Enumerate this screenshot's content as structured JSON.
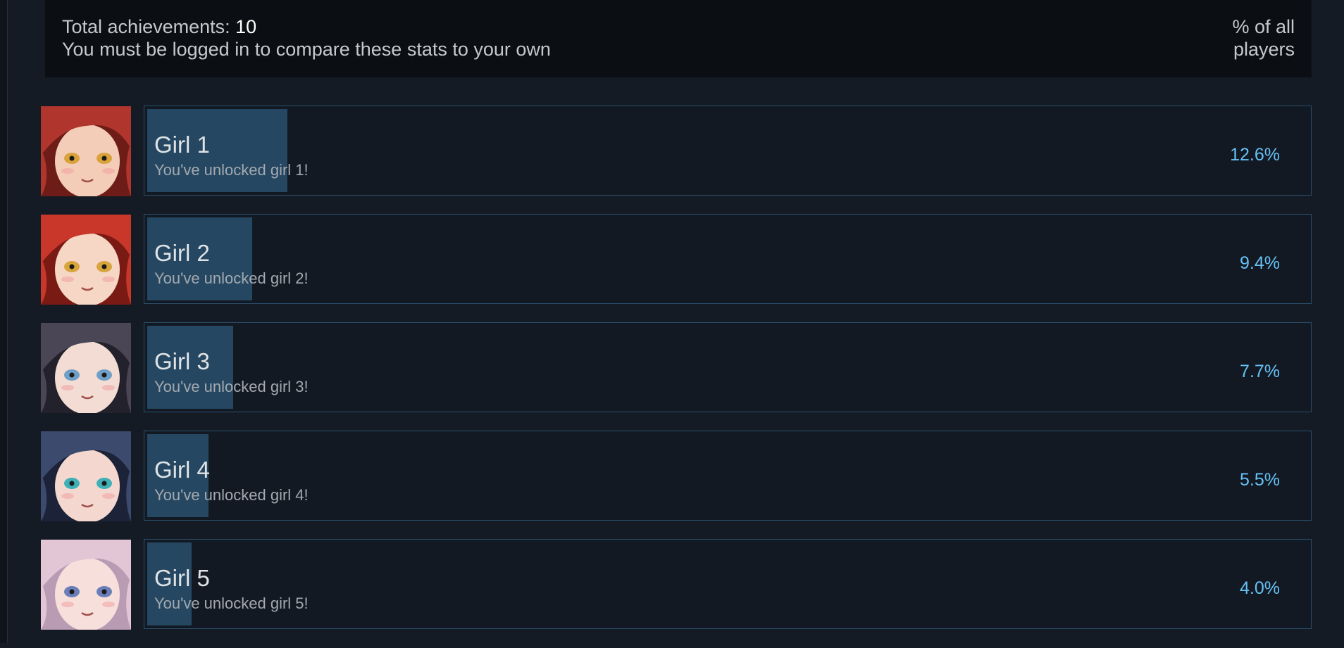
{
  "header": {
    "total_label": "Total achievements: ",
    "total_value": "10",
    "login_notice": "You must be logged in to compare these stats to your own",
    "percent_label": "% of all players"
  },
  "colors": {
    "background": "#151b25",
    "header_bg": "#0b0e13",
    "card_bg": "#121923",
    "card_border": "#2a4e6c",
    "progress_fill": "#254761",
    "percent_text": "#67c1f5"
  },
  "achievements": [
    {
      "title": "Girl 1",
      "description": "You've unlocked girl 1!",
      "percent": "12.6%",
      "progress": 0.126,
      "icon": "girl-1-portrait-icon",
      "hair": "#b0352c",
      "hair_dark": "#6e1c17",
      "skin": "#f3cdb8",
      "eye": "#d9a23a"
    },
    {
      "title": "Girl 2",
      "description": "You've unlocked girl 2!",
      "percent": "9.4%",
      "progress": 0.094,
      "icon": "girl-2-portrait-icon",
      "hair": "#c9362a",
      "hair_dark": "#7a1a14",
      "skin": "#f6d6c4",
      "eye": "#d8a53c"
    },
    {
      "title": "Girl 3",
      "description": "You've unlocked girl 3!",
      "percent": "7.7%",
      "progress": 0.077,
      "icon": "girl-3-portrait-icon",
      "hair": "#4a4656",
      "hair_dark": "#23212b",
      "skin": "#f3dcd3",
      "eye": "#6f9fc7"
    },
    {
      "title": "Girl 4",
      "description": "You've unlocked girl 4!",
      "percent": "5.5%",
      "progress": 0.055,
      "icon": "girl-4-portrait-icon",
      "hair": "#3c4a6d",
      "hair_dark": "#1c2238",
      "skin": "#f4d8cf",
      "eye": "#3fb0b6"
    },
    {
      "title": "Girl 5",
      "description": "You've unlocked girl 5!",
      "percent": "4.0%",
      "progress": 0.04,
      "icon": "girl-5-portrait-icon",
      "hair": "#e2c6d6",
      "hair_dark": "#b99bb3",
      "skin": "#f7dfdb",
      "eye": "#6a7fb8"
    }
  ]
}
